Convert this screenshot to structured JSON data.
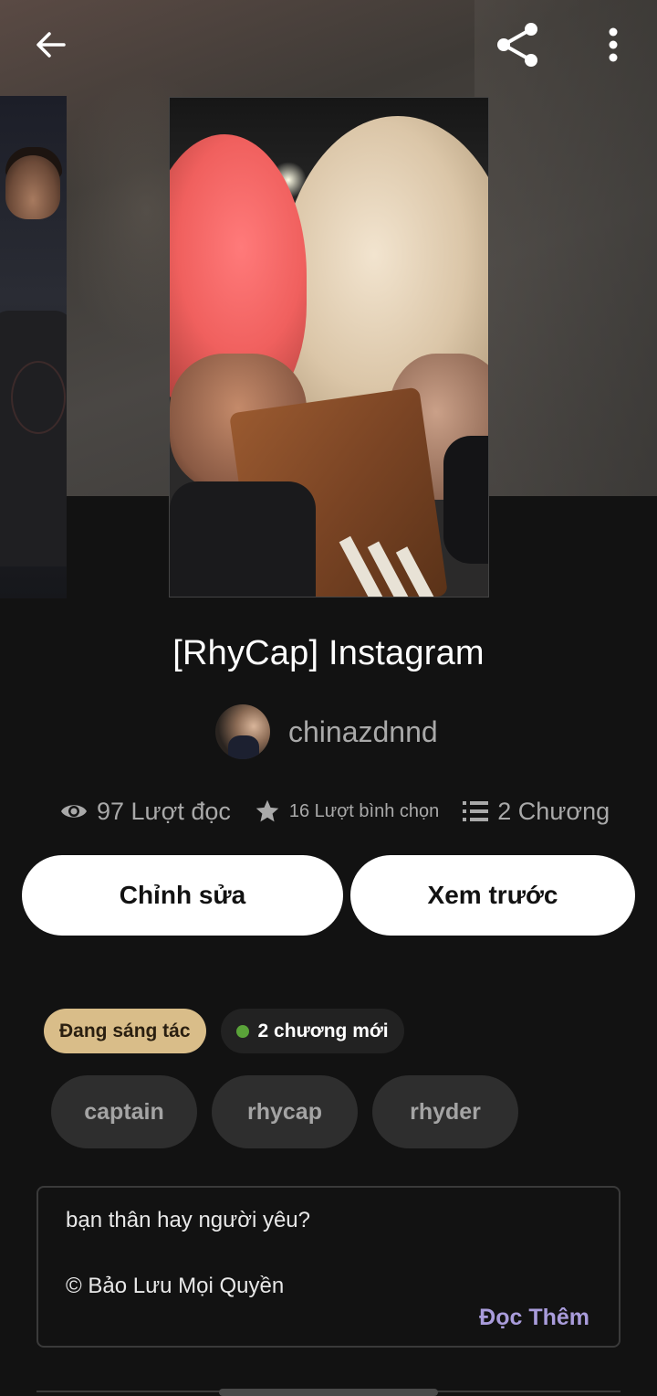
{
  "toolbar": {
    "back_icon": "arrow-left-icon",
    "share_icon": "share-icon",
    "more_icon": "more-vertical-icon"
  },
  "story": {
    "title": "[RhyCap] Instagram",
    "author": "chinazdnnd"
  },
  "stats": {
    "reads": "97 Lượt đọc",
    "votes": "16 Lượt bình chọn",
    "chapters": "2 Chương"
  },
  "actions": {
    "edit_label": "Chỉnh sửa",
    "preview_label": "Xem trước"
  },
  "badges": {
    "status": "Đang sáng tác",
    "new_chapters": "2 chương mới"
  },
  "tags": [
    "captain",
    "rhycap",
    "rhyder"
  ],
  "description": {
    "line1": "bạn thân hay người yêu?",
    "line2": "© Bảo Lưu Mọi Quyền",
    "read_more": "Đọc Thêm"
  },
  "colors": {
    "background": "#121212",
    "status_badge": "#d9bd89",
    "new_dot": "#5aa339",
    "read_more": "#a99cdb"
  }
}
